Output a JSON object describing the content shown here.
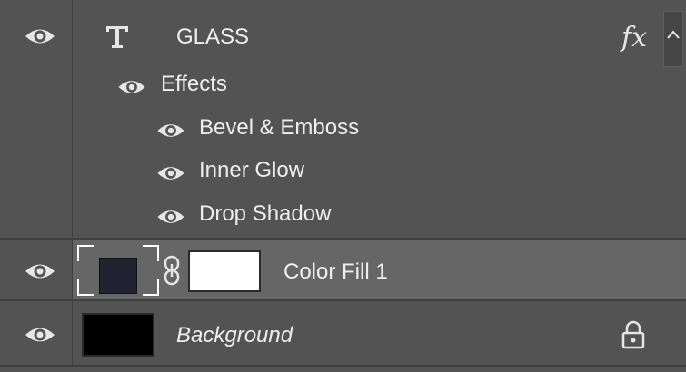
{
  "layers": [
    {
      "name": "GLASS",
      "type": "text",
      "type_icon": "text-layer-icon",
      "fx_label": "fx",
      "effects_label": "Effects",
      "effects": [
        "Bevel & Emboss",
        "Inner Glow",
        "Drop Shadow"
      ]
    },
    {
      "name": "Color Fill 1",
      "type": "fill",
      "swatch_color": "#222233",
      "mask_color": "#ffffff",
      "selected": true
    },
    {
      "name": "Background",
      "type": "background",
      "thumb_color": "#000000",
      "locked": true
    }
  ],
  "colors": {
    "panel_bg": "#535353",
    "selected_bg": "#666666",
    "text": "#eeeeee",
    "icon": "#e6e6e6",
    "separator": "#3f3f3f"
  },
  "icons": {
    "visibility": "eye-icon",
    "collapse": "chevron-up-icon",
    "link": "link-chain-icon",
    "lock": "lock-icon"
  }
}
